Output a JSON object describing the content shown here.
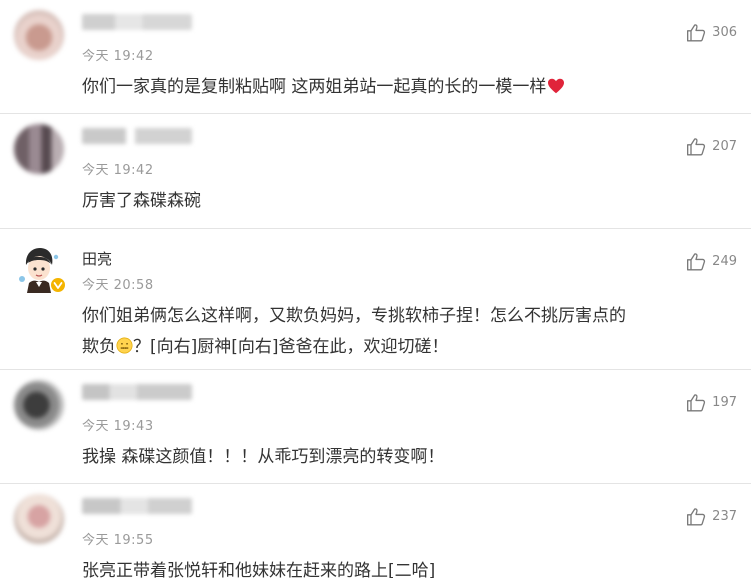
{
  "comments": [
    {
      "time": "今天 19:42",
      "text": "你们一家真的是复制粘贴啊  这两姐弟站一起真的长的一模一样",
      "emoji": "heart-icon",
      "likes": "306"
    },
    {
      "time": "今天 19:42",
      "text": "厉害了森碟森碗",
      "likes": "207"
    },
    {
      "username": "田亮",
      "time": "今天 20:58",
      "text_line1": "你们姐弟俩怎么这样啊，又欺负妈妈，专挑软柿子捏！怎么不挑厉害点的",
      "text_line2_a": "欺负",
      "emoji": "zipper-mouth-face-icon",
      "text_line2_b": "？[向右]厨神[向右]爸爸在此，欢迎切磋！",
      "likes": "249",
      "verified": true
    },
    {
      "time": "今天 19:43",
      "text": "我操  森碟这颜值！！！从乖巧到漂亮的转变啊！",
      "likes": "197"
    },
    {
      "time": "今天 19:55",
      "text": "张亮正带着张悦轩和他妹妹在赶来的路上[二哈]",
      "likes": "237"
    }
  ],
  "colors": {
    "text": "#333333",
    "meta": "#9a9a9a",
    "divider": "#e4e4e4",
    "heart": "#e0243a",
    "verified": "#f4b400"
  }
}
